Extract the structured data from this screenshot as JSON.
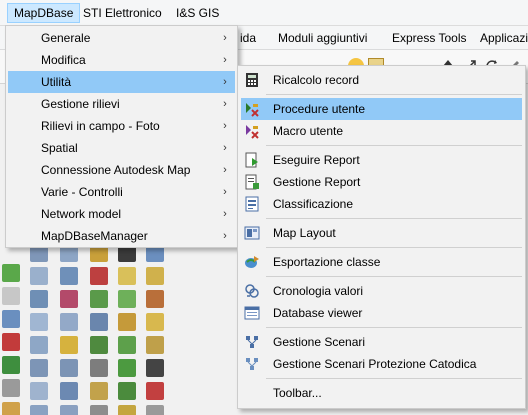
{
  "menubar": {
    "items": [
      {
        "label": "MapDBase",
        "active": true
      },
      {
        "label": "STI Elettronico"
      },
      {
        "label": "I&S GIS"
      }
    ]
  },
  "tabbar": {
    "visible_tabs": [
      "ida",
      "Moduli aggiuntivi",
      "Express Tools",
      "Applicazi"
    ]
  },
  "mapdbase_menu": {
    "items": [
      {
        "label": "Generale",
        "has_submenu": true
      },
      {
        "label": "Modifica",
        "has_submenu": true
      },
      {
        "label": "Utilità",
        "has_submenu": true,
        "active": true
      },
      {
        "label": "Gestione rilievi",
        "has_submenu": true
      },
      {
        "label": "Rilievi in campo - Foto",
        "has_submenu": true
      },
      {
        "label": "Spatial",
        "has_submenu": true
      },
      {
        "label": "Connessione Autodesk Map",
        "has_submenu": true
      },
      {
        "label": "Varie - Controlli",
        "has_submenu": true
      },
      {
        "label": "Network model",
        "has_submenu": true
      },
      {
        "label": "MapDBaseManager",
        "has_submenu": true
      }
    ],
    "arrow_glyph": "›"
  },
  "utilita_submenu": {
    "groups": [
      [
        {
          "label": "Ricalcolo record",
          "icon": "calculator-icon"
        }
      ],
      [
        {
          "label": "Procedure utente",
          "icon": "procedure-icon",
          "active": true
        },
        {
          "label": "Macro utente",
          "icon": "macro-icon"
        }
      ],
      [
        {
          "label": "Eseguire Report",
          "icon": "run-report-icon"
        },
        {
          "label": "Gestione Report",
          "icon": "report-manager-icon"
        },
        {
          "label": "Classificazione",
          "icon": "classification-icon"
        }
      ],
      [
        {
          "label": "Map Layout",
          "icon": "map-layout-icon"
        }
      ],
      [
        {
          "label": "Esportazione classe",
          "icon": "export-class-icon"
        }
      ],
      [
        {
          "label": "Cronologia valori",
          "icon": "history-icon"
        },
        {
          "label": "Database viewer",
          "icon": "database-viewer-icon"
        }
      ],
      [
        {
          "label": "Gestione Scenari",
          "icon": "scenario-icon"
        },
        {
          "label": "Gestione Scenari Protezione Catodica",
          "icon": "cathodic-scenario-icon"
        }
      ],
      [
        {
          "label": "Toolbar...",
          "icon": ""
        }
      ]
    ]
  },
  "colors": {
    "menu_bg": "#f2f2f2",
    "highlight": "#91c9f7",
    "menubar_active": "#cce8ff"
  }
}
